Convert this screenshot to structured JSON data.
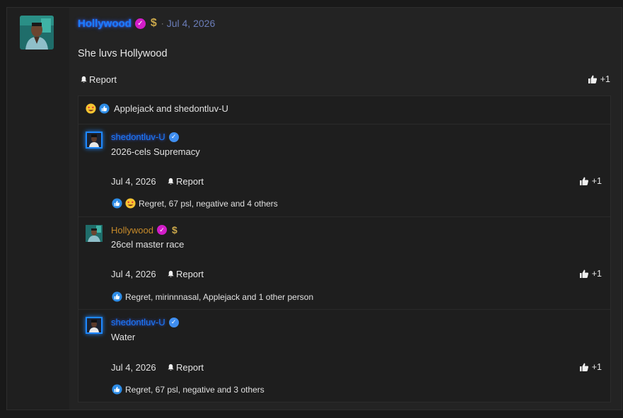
{
  "post": {
    "author": "Hollywood",
    "date": "Jul 4, 2026",
    "body": "She luvs Hollywood",
    "report_label": "Report",
    "like_count": "+1",
    "reactions_summary": "Applejack and shedontluv-U"
  },
  "comments": [
    {
      "author": "shedontluv-U",
      "text": "2026-cels Supremacy",
      "date": "Jul 4, 2026",
      "report_label": "Report",
      "like_count": "+1",
      "reactions": "Regret, 67 psl, negative and 4 others"
    },
    {
      "author": "Hollywood",
      "text": "26cel master race",
      "date": "Jul 4, 2026",
      "report_label": "Report",
      "like_count": "+1",
      "reactions": "Regret, mirinnnasal, Applejack and 1 other person"
    },
    {
      "author": "shedontluv-U",
      "text": "Water",
      "date": "Jul 4, 2026",
      "report_label": "Report",
      "like_count": "+1",
      "reactions": "Regret, 67 psl, negative and 3 others"
    }
  ],
  "colors": {
    "background": "#191919",
    "author_blue": "#1a7dff",
    "author_gold": "#c68a2a",
    "badge_magenta": "#d21dc8",
    "badge_blue": "#3f8ef0",
    "date_link": "#6b7db8"
  },
  "icons": {
    "verified": "check-badge-icon",
    "dollar": "dollar-sign-icon",
    "report": "bell-icon",
    "like": "thumbs-up-icon",
    "love": "heart-eyes-emoji-icon"
  }
}
